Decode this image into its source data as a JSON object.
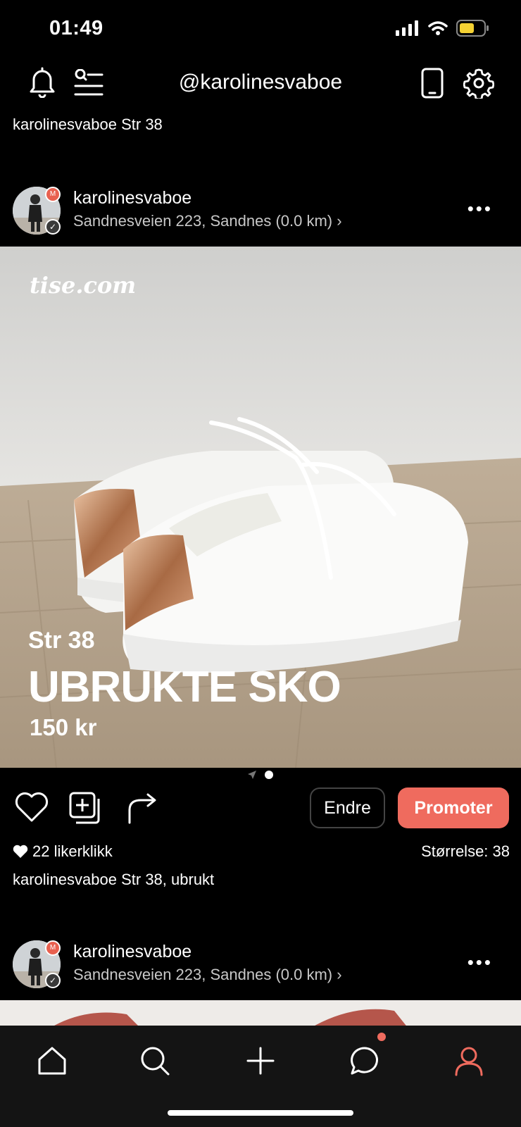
{
  "status": {
    "time": "01:49"
  },
  "nav": {
    "title": "@karolinesvaboe"
  },
  "profile": {
    "caption": "karolinesvaboe Str 38"
  },
  "post1": {
    "user": "karolinesvaboe",
    "location": "Sandnesveien 223, Sandnes (0.0 km) ›",
    "image": {
      "watermark": "tise.com",
      "sub": "Str 38",
      "title": "UBRUKTE SKO",
      "price": "150 kr"
    },
    "actions": {
      "edit_label": "Endre",
      "promote_label": "Promoter"
    },
    "likes": "22 likerklikk",
    "size": "Størrelse: 38",
    "description": "karolinesvaboe Str 38, ubrukt"
  },
  "post2": {
    "user": "karolinesvaboe",
    "location": "Sandnesveien 223, Sandnes (0.0 km) ›"
  },
  "avatar_badge": "M",
  "icons": {
    "top_left": [
      "bell-icon",
      "search-list-icon"
    ],
    "top_right": [
      "phone-icon",
      "settings-gear-icon"
    ],
    "actions": [
      "heart-icon",
      "add-collection-icon",
      "share-arrow-icon"
    ],
    "tabs": [
      "home-icon",
      "search-icon",
      "plus-icon",
      "chat-icon",
      "profile-icon"
    ]
  },
  "colors": {
    "accent": "#ef6b5e",
    "background": "#000000",
    "tabbar": "#141414"
  }
}
